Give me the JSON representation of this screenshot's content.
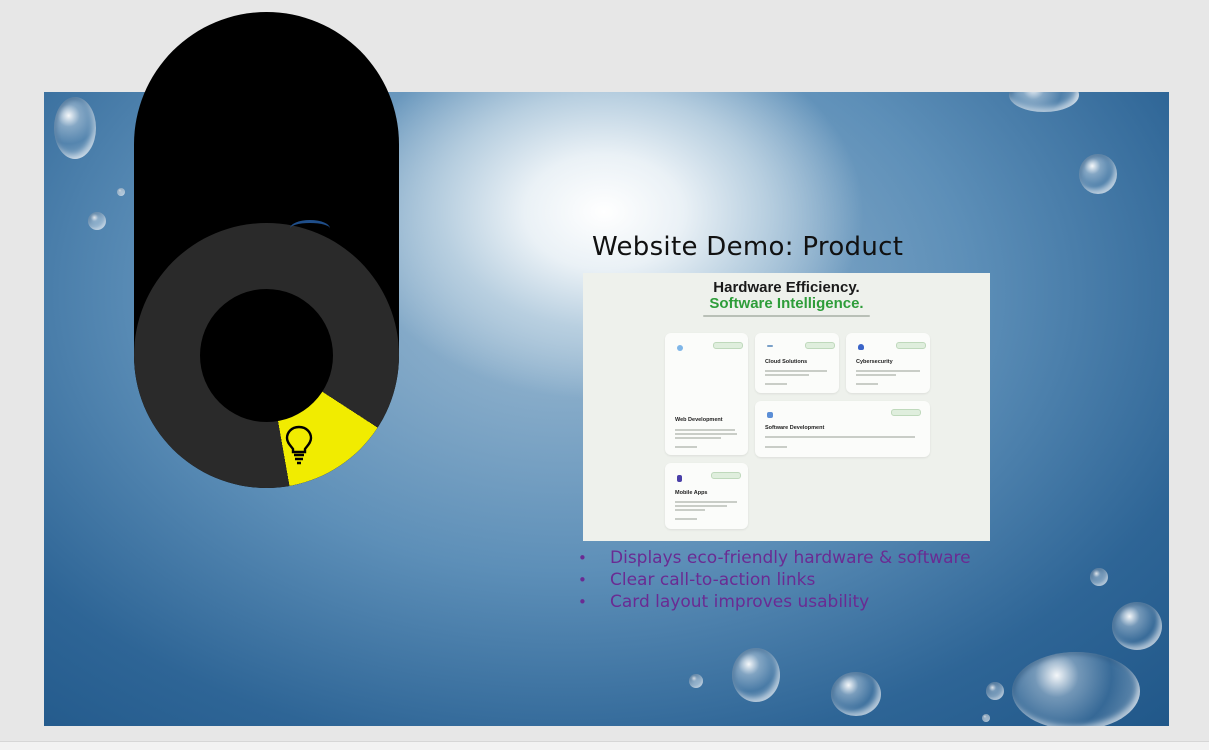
{
  "slide": {
    "title": "Website Demo: Product",
    "screenshot": {
      "heading_line1": "Hardware Efficiency.",
      "heading_line2": "Software Intelligence.",
      "cards": [
        {
          "title": "Web Development"
        },
        {
          "title": "Cloud Solutions"
        },
        {
          "title": "Cybersecurity"
        },
        {
          "title": "Software Development"
        },
        {
          "title": "Mobile Apps"
        }
      ]
    },
    "bullets": [
      "Displays eco-friendly hardware & software",
      "Clear call-to-action links",
      "Card layout improves usability"
    ]
  },
  "overlay": {
    "icon": "lightbulb-icon",
    "accent_color": "#f1ec00",
    "ring_color": "#2a2a2a"
  },
  "colors": {
    "bullet_text": "#6a2b93",
    "heading_green": "#2e9d3a"
  }
}
